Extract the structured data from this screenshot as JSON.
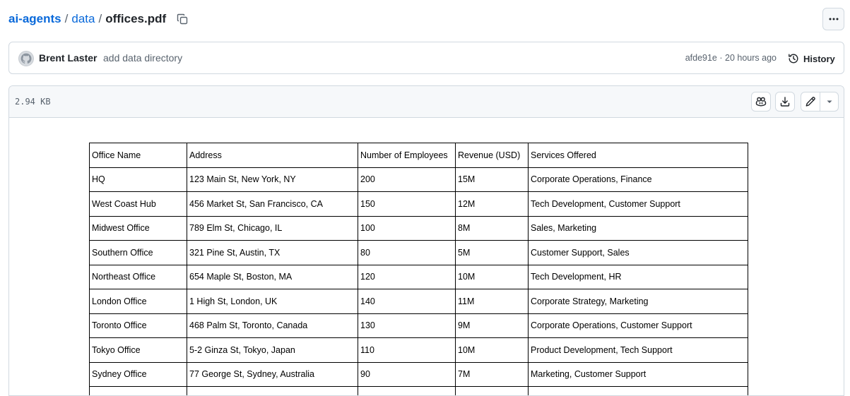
{
  "breadcrumb": {
    "repo": "ai-agents",
    "folder": "data",
    "file": "offices.pdf",
    "separator": "/"
  },
  "commit": {
    "author": "Brent Laster",
    "message": "add data directory",
    "sha": "afde91e",
    "separator": "·",
    "time": "20 hours ago",
    "history_label": "History"
  },
  "file": {
    "size": "2.94 KB"
  },
  "icons": {
    "copy": "copy-icon",
    "more": "kebab-horizontal-icon",
    "history": "history-icon",
    "copilot": "copilot-icon",
    "download": "download-icon",
    "edit": "pencil-icon",
    "caret": "triangle-down-icon"
  },
  "colors": {
    "link": "#0969da",
    "muted": "#59636e",
    "border": "#d1d9e0",
    "header_bg": "#f6f8fa"
  },
  "table": {
    "headers": [
      "Office Name",
      "Address",
      "Number of Employees",
      "Revenue (USD)",
      "Services Offered"
    ],
    "rows": [
      [
        "HQ",
        "123 Main St, New York, NY",
        "200",
        "15M",
        "Corporate Operations, Finance"
      ],
      [
        "West Coast Hub",
        "456 Market St, San Francisco, CA",
        "150",
        "12M",
        "Tech Development, Customer Support"
      ],
      [
        "Midwest Office",
        "789 Elm St, Chicago, IL",
        "100",
        "8M",
        "Sales, Marketing"
      ],
      [
        "Southern Office",
        "321 Pine St, Austin, TX",
        "80",
        "5M",
        "Customer Support, Sales"
      ],
      [
        "Northeast Office",
        "654 Maple St, Boston, MA",
        "120",
        "10M",
        "Tech Development, HR"
      ],
      [
        "London Office",
        "1 High St, London, UK",
        "140",
        "11M",
        "Corporate Strategy, Marketing"
      ],
      [
        "Toronto Office",
        "468 Palm St, Toronto, Canada",
        "130",
        "9M",
        "Corporate Operations, Customer Support"
      ],
      [
        "Tokyo Office",
        "5-2 Ginza St, Tokyo, Japan",
        "110",
        "10M",
        "Product Development, Tech Support"
      ],
      [
        "Sydney Office",
        "77 George St, Sydney, Australia",
        "90",
        "7M",
        "Marketing, Customer Support"
      ],
      [
        "",
        "",
        "",
        "",
        ""
      ]
    ]
  }
}
